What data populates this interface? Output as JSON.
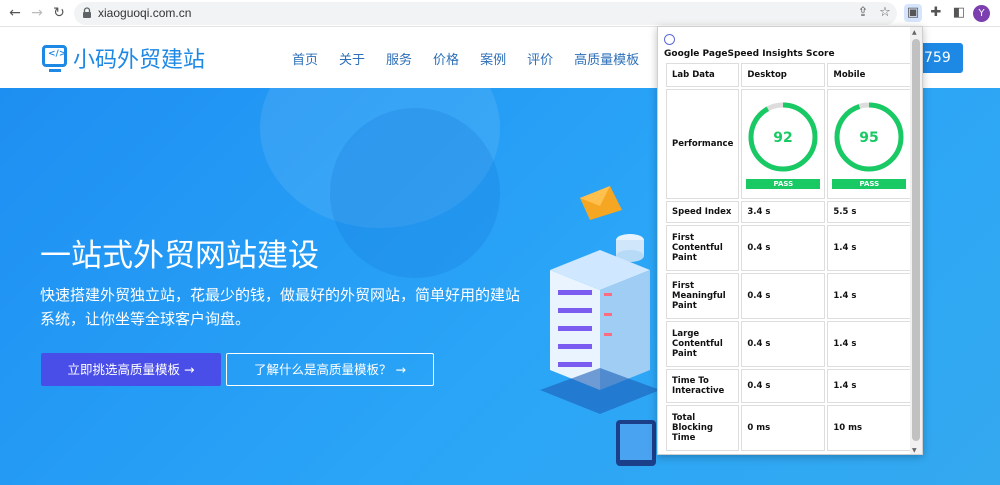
{
  "browser": {
    "url": "xiaoguoqi.com.cn",
    "avatar_letter": "Y"
  },
  "site": {
    "logo_mark": "</>",
    "logo_text": "小码外贸建站",
    "menu": [
      "首页",
      "关于",
      "服务",
      "价格",
      "案例",
      "评价",
      "高质量模板"
    ],
    "menu_dropdown_icon": "chevron-down-icon",
    "phone_partial": "759"
  },
  "hero": {
    "title": "一站式外贸网站建设",
    "subtitle": "快速搭建外贸独立站，花最少的钱，做最好的外贸网站，简单好用的建站系统，让你坐等全球客户询盘。",
    "primary_button": "立即挑选高质量模板 →",
    "secondary_button": "了解什么是高质量模板？ →"
  },
  "popup": {
    "title": "Google PageSpeed Insights Score",
    "headers": [
      "Lab Data",
      "Desktop",
      "Mobile"
    ],
    "performance_label": "Performance",
    "desktop_score": 92,
    "mobile_score": 95,
    "pass_label": "PASS",
    "gauge_color": "#18c964",
    "rows": [
      {
        "label": "Speed Index",
        "desktop": "3.4 s",
        "mobile": "5.5 s"
      },
      {
        "label": "First Contentful Paint",
        "desktop": "0.4 s",
        "mobile": "1.4 s"
      },
      {
        "label": "First Meaningful Paint",
        "desktop": "0.4 s",
        "mobile": "1.4 s"
      },
      {
        "label": "Large Contentful Paint",
        "desktop": "0.4 s",
        "mobile": "1.4 s"
      },
      {
        "label": "Time To Interactive",
        "desktop": "0.4 s",
        "mobile": "1.4 s"
      },
      {
        "label": "Total Blocking Time",
        "desktop": "0 ms",
        "mobile": "10 ms"
      }
    ]
  }
}
